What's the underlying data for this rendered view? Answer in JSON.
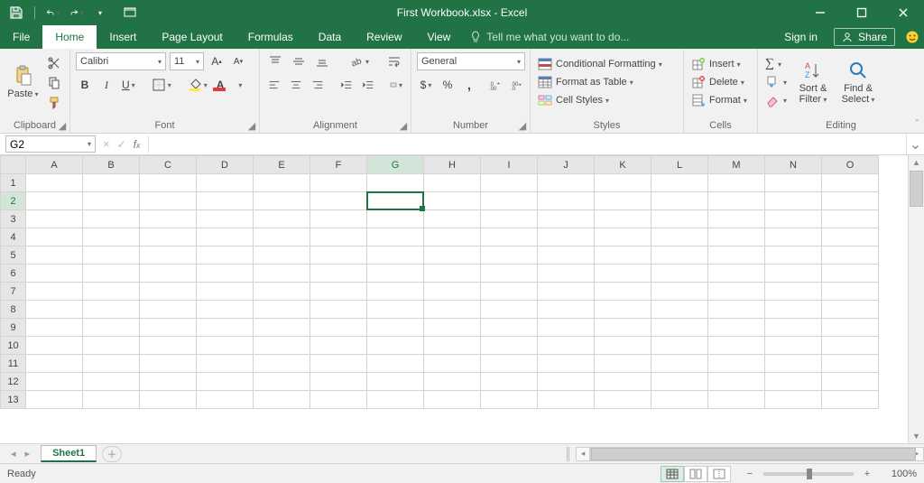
{
  "title": "First Workbook.xlsx - Excel",
  "tabs": [
    "File",
    "Home",
    "Insert",
    "Page Layout",
    "Formulas",
    "Data",
    "Review",
    "View"
  ],
  "active_tab": "Home",
  "tellme_placeholder": "Tell me what you want to do...",
  "signin": "Sign in",
  "share": "Share",
  "ribbon": {
    "clipboard": {
      "label": "Clipboard",
      "paste": "Paste"
    },
    "font": {
      "label": "Font",
      "name": "Calibri",
      "size": "11"
    },
    "alignment": {
      "label": "Alignment"
    },
    "number": {
      "label": "Number",
      "format": "General"
    },
    "styles": {
      "label": "Styles",
      "cond": "Conditional Formatting",
      "table": "Format as Table",
      "cell": "Cell Styles"
    },
    "cells": {
      "label": "Cells",
      "insert": "Insert",
      "delete": "Delete",
      "format": "Format"
    },
    "editing": {
      "label": "Editing",
      "sort": "Sort & Filter",
      "find": "Find & Select"
    }
  },
  "namebox": "G2",
  "formula": "",
  "columns": [
    "A",
    "B",
    "C",
    "D",
    "E",
    "F",
    "G",
    "H",
    "I",
    "J",
    "K",
    "L",
    "M",
    "N",
    "O"
  ],
  "rows": [
    1,
    2,
    3,
    4,
    5,
    6,
    7,
    8,
    9,
    10,
    11,
    12,
    13
  ],
  "selected": {
    "col": "G",
    "row": 2
  },
  "sheet_tab": "Sheet1",
  "status_text": "Ready",
  "zoom": "100%"
}
